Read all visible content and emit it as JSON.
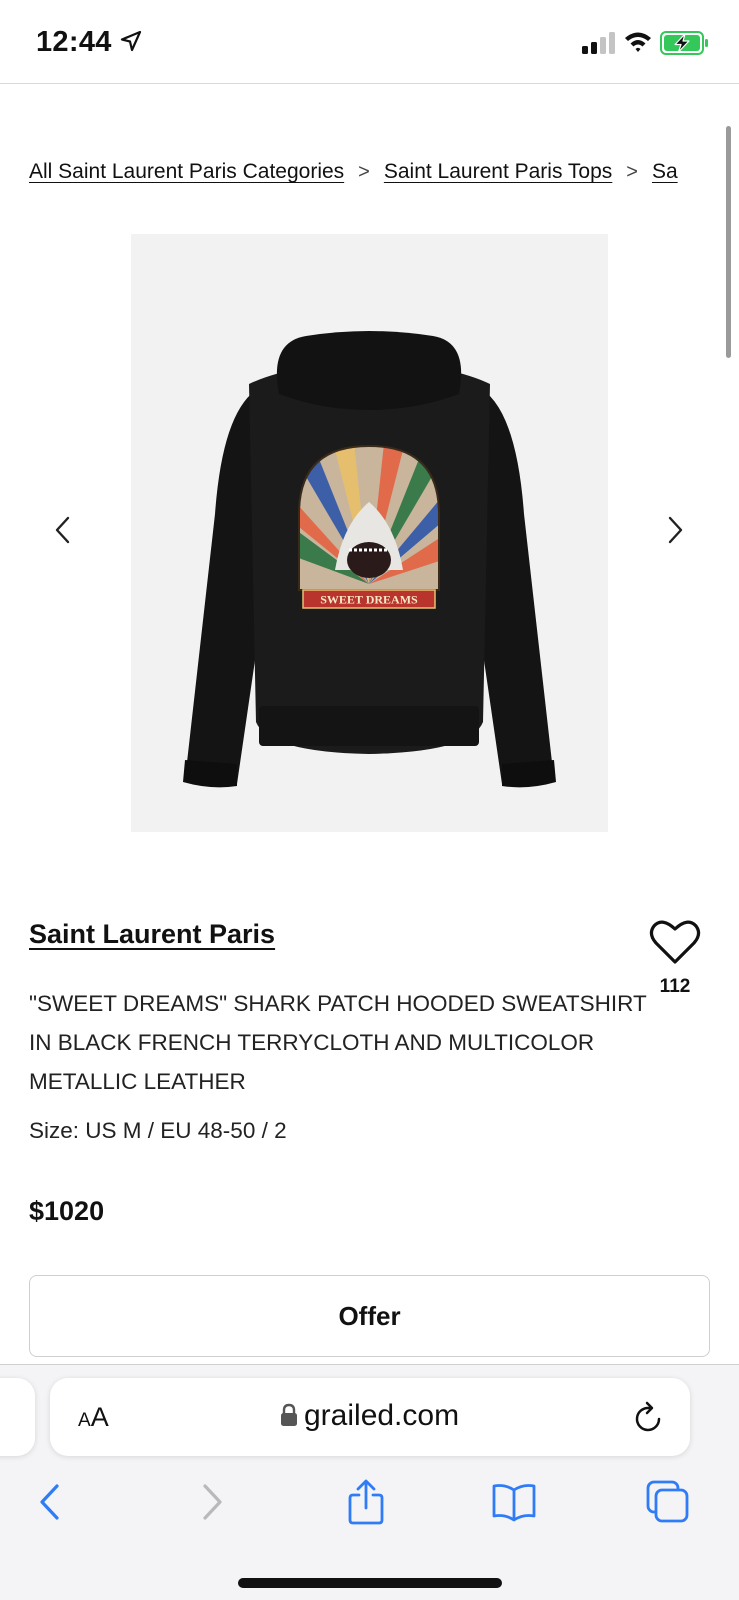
{
  "status_bar": {
    "time": "12:44",
    "icons": [
      "location-arrow-icon",
      "signal-icon",
      "wifi-icon",
      "battery-charging-icon"
    ]
  },
  "breadcrumb": {
    "items": [
      "All Saint Laurent Paris Categories",
      "Saint Laurent Paris Tops",
      "Sa"
    ],
    "separator": ">"
  },
  "product": {
    "image_text": "SWEET DREAMS",
    "brand": "Saint Laurent Paris",
    "favorites_count": "112",
    "title": "\"SWEET DREAMS\" SHARK PATCH HOODED SWEATSHIRT IN BLACK FRENCH TERRYCLOTH AND MULTICOLOR METALLIC LEATHER",
    "size": "Size: US M / EU 48-50 / 2",
    "price": "$1020",
    "offer_label": "Offer"
  },
  "carousel": {
    "prev_icon": "chevron-left-icon",
    "next_icon": "chevron-right-icon"
  },
  "browser": {
    "text_size_big": "A",
    "text_size_small": "A",
    "url": "grailed.com",
    "toolbar_icons": [
      "back-icon",
      "forward-icon",
      "share-icon",
      "bookmarks-icon",
      "tabs-icon"
    ]
  },
  "colors": {
    "accent_blue": "#2f7cf6",
    "battery_green": "#34c759",
    "text": "#111111"
  }
}
